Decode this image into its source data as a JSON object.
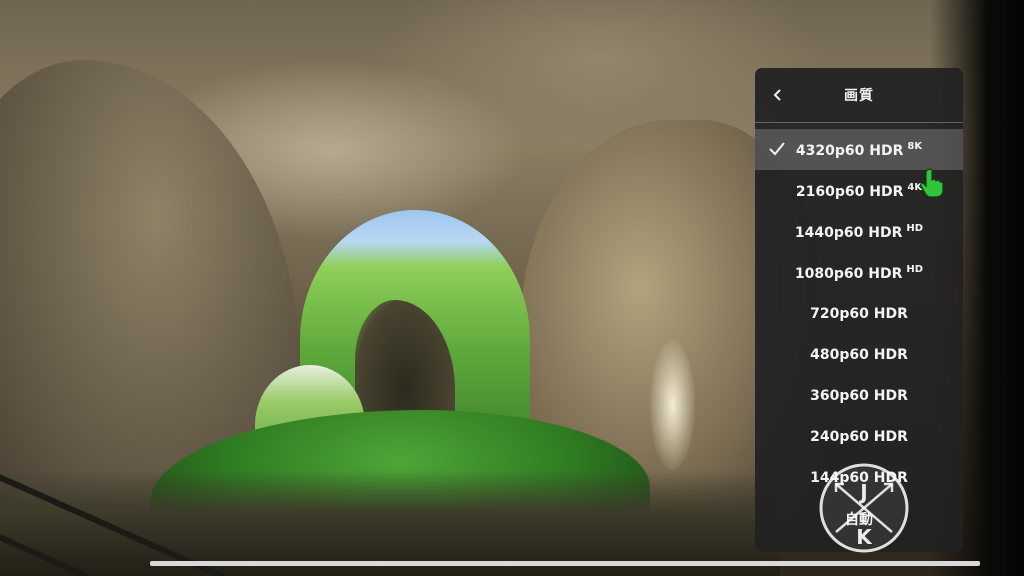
{
  "menu": {
    "title": "画質",
    "items": [
      {
        "label": "4320p60 HDR",
        "badge": "8K",
        "selected": true
      },
      {
        "label": "2160p60 HDR",
        "badge": "4K",
        "selected": false
      },
      {
        "label": "1440p60 HDR",
        "badge": "HD",
        "selected": false
      },
      {
        "label": "1080p60 HDR",
        "badge": "HD",
        "selected": false
      },
      {
        "label": "720p60 HDR",
        "badge": "",
        "selected": false
      },
      {
        "label": "480p60 HDR",
        "badge": "",
        "selected": false
      },
      {
        "label": "360p60 HDR",
        "badge": "",
        "selected": false
      },
      {
        "label": "240p60 HDR",
        "badge": "",
        "selected": false
      },
      {
        "label": "144p60 HDR",
        "badge": "",
        "selected": false
      },
      {
        "label": "自動",
        "badge": "",
        "selected": false
      }
    ]
  },
  "watermark": {
    "letter_top": "J",
    "letter_bottom": "K"
  },
  "icons": {
    "back": "chevron-left-icon",
    "check": "checkmark-icon",
    "cursor": "pointing-hand-cursor-icon"
  },
  "colors": {
    "menu_bg": "#212121",
    "selected_bg": "#4d4d4d",
    "text": "#f1f1f1",
    "cursor_green": "#35c23b"
  }
}
